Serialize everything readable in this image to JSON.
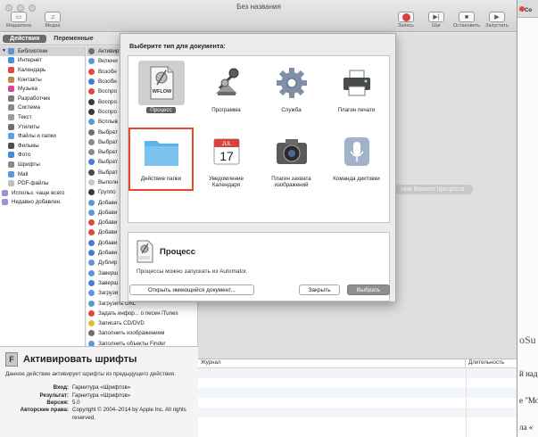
{
  "window": {
    "title": "Без названия"
  },
  "toolbar": {
    "left": [
      {
        "label": "Медиатека",
        "icon": "library-icon"
      },
      {
        "label": "Медиа",
        "icon": "media-icon"
      }
    ],
    "right": [
      {
        "label": "Запись",
        "icon": "record-icon"
      },
      {
        "label": "Шаг",
        "icon": "step-icon"
      },
      {
        "label": "Остановить",
        "icon": "stop-icon"
      },
      {
        "label": "Запустить",
        "icon": "run-icon"
      }
    ]
  },
  "tabs": {
    "actions": "Действия",
    "variables": "Переменные"
  },
  "library": [
    {
      "label": "Библиотеки",
      "color": "#6a8fd0"
    },
    {
      "label": "Интернет",
      "color": "#4a90d9"
    },
    {
      "label": "Календарь",
      "color": "#e3483a"
    },
    {
      "label": "Контакты",
      "color": "#b48b5a"
    },
    {
      "label": "Музыка",
      "color": "#d94a8c"
    },
    {
      "label": "Разработчик",
      "color": "#7a7a7a"
    },
    {
      "label": "Система",
      "color": "#8a8a8a"
    },
    {
      "label": "Текст",
      "color": "#9a9a9a"
    },
    {
      "label": "Утилиты",
      "color": "#6f6f6f"
    },
    {
      "label": "Файлы и папки",
      "color": "#5f9fe0"
    },
    {
      "label": "Фильмы",
      "color": "#4f4f4f"
    },
    {
      "label": "Фото",
      "color": "#3f8fd0"
    },
    {
      "label": "Шрифты",
      "color": "#8a8a8a"
    },
    {
      "label": "Mail",
      "color": "#5a9ad9"
    },
    {
      "label": "PDF-файлы",
      "color": "#c0c0c0"
    },
    {
      "label": "Использ. чаще всего",
      "color": "#a58fd0"
    },
    {
      "label": "Недавно добавлен.",
      "color": "#a58fd0"
    }
  ],
  "actions": [
    {
      "label": "Активир",
      "color": "#6f6f6f"
    },
    {
      "label": "Включи",
      "color": "#5a9ad9"
    },
    {
      "label": "Возобн",
      "color": "#e3483a"
    },
    {
      "label": "Возобн",
      "color": "#4a7ad9"
    },
    {
      "label": "Воспро",
      "color": "#e3483a"
    },
    {
      "label": "Воспро",
      "color": "#3a3a3a"
    },
    {
      "label": "Воспро",
      "color": "#3a3a3a"
    },
    {
      "label": "Всплыв",
      "color": "#5a9ad9"
    },
    {
      "label": "Выбрат",
      "color": "#6f6f6f"
    },
    {
      "label": "Выбрат",
      "color": "#8a8a8a"
    },
    {
      "label": "Выбрат",
      "color": "#8a8a8a"
    },
    {
      "label": "Выбрат",
      "color": "#4a7ad9"
    },
    {
      "label": "Выбрат",
      "color": "#4a4a4a"
    },
    {
      "label": "Выполн",
      "color": "#c8c8c8"
    },
    {
      "label": "Группо",
      "color": "#3a3a3a"
    },
    {
      "label": "Добави",
      "color": "#5a9ad9"
    },
    {
      "label": "Добави",
      "color": "#5a9ad9"
    },
    {
      "label": "Добави",
      "color": "#e3483a"
    },
    {
      "label": "Добави",
      "color": "#e3483a"
    },
    {
      "label": "Добави",
      "color": "#4a7ad9"
    },
    {
      "label": "Добави",
      "color": "#4a7ad9"
    },
    {
      "label": "Дублир",
      "color": "#5a9ad9"
    },
    {
      "label": "Заверш",
      "color": "#5a9ad9"
    },
    {
      "label": "Заверш",
      "color": "#4a7ad9"
    },
    {
      "label": "Загрузи",
      "color": "#5a9ad9"
    },
    {
      "label": "Загрузить URL",
      "color": "#5a9ad9"
    },
    {
      "label": "Задать инфор... о песен iTunes",
      "color": "#e3483a"
    },
    {
      "label": "Записать CD/DVD",
      "color": "#e0c030"
    },
    {
      "label": "Заполнить изображением",
      "color": "#6f6f6f"
    },
    {
      "label": "Заполнить объекты Finder",
      "color": "#5a9ad9"
    }
  ],
  "description": {
    "title": "Активировать шрифты",
    "text": "Данное действие активирует шрифты из предыдущего действия.",
    "meta": [
      {
        "key": "Вход:",
        "value": "Гарнитура «Шрифтов»"
      },
      {
        "key": "Результат:",
        "value": "Гарнитура «Шрифтов»"
      },
      {
        "key": "Версия:",
        "value": "5.0"
      },
      {
        "key": "Авторские права:",
        "value": "Copyright © 2004–2014 by Apple Inc. All rights reserved."
      }
    ]
  },
  "workflow": {
    "drag_hint": "ния Вашего процесса."
  },
  "log": {
    "col_journal": "Журнал",
    "col_duration": "Длительность"
  },
  "sheet": {
    "title": "Выберите тип для документа:",
    "types": [
      {
        "label": "Процесс",
        "icon": "workflow-icon",
        "selected": true
      },
      {
        "label": "Программа",
        "icon": "application-icon"
      },
      {
        "label": "Служба",
        "icon": "service-gear-icon"
      },
      {
        "label": "Плагин печати",
        "icon": "printer-icon"
      },
      {
        "label": "Действие папки",
        "icon": "folder-icon",
        "highlighted": true
      },
      {
        "label": "Уведомление Календаря",
        "icon": "calendar-icon"
      },
      {
        "label": "Плагин захвата изображений",
        "icon": "camera-icon"
      },
      {
        "label": "Команда диктовки",
        "icon": "microphone-icon"
      }
    ],
    "calendar": {
      "month": "JUL",
      "day": "17"
    },
    "workflow_badge": "WFLOW",
    "detail": {
      "title": "Процесс",
      "text": "Процессы можно запускать из Automator."
    },
    "buttons": {
      "open": "Открыть имеющийся документ...",
      "close": "Закрыть",
      "choose": "Выбрать"
    }
  },
  "right_fragment": {
    "tab_text": "Co",
    "snippets": [
      "oSu",
      "й над",
      "е \"Мо",
      "ла «"
    ]
  }
}
